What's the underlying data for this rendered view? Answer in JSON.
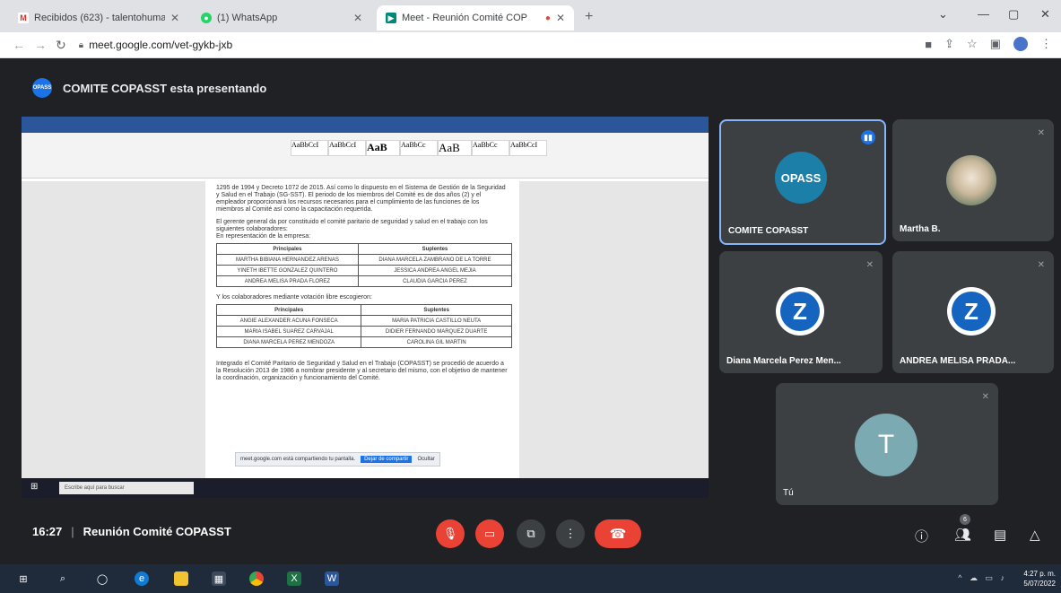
{
  "browser": {
    "tabs": [
      {
        "title": "Recibidos (623) - talentohumano",
        "active": false
      },
      {
        "title": "(1) WhatsApp",
        "active": false
      },
      {
        "title": "Meet - Reunión Comité COP",
        "active": true
      }
    ],
    "url": "meet.google.com/vet-gykb-jxb"
  },
  "meet": {
    "presenting_banner": "COMITE COPASST esta presentando",
    "presenter_badge": "OPASS",
    "time": "16:27",
    "meeting_name": "Reunión Comité COPASST",
    "participants_count": "6",
    "participants": [
      {
        "name": "COMITE COPASST",
        "avatar_text": "OPASS"
      },
      {
        "name": "Martha B."
      },
      {
        "name": "Diana Marcela Perez Men..."
      },
      {
        "name": "ANDREA MELISA PRADA..."
      },
      {
        "name": "Tú",
        "avatar_text": "T"
      }
    ]
  },
  "document": {
    "paragraph1": "1295 de 1994 y Decreto 1072 de 2015. Así como lo dispuesto en el Sistema de Gestión de la Seguridad y Salud en el Trabajo (SG-SST). El periodo de los miembros del Comité es de dos años (2) y el empleador proporcionará los recursos necesarios para el cumplimiento de las funciones de los miembros al Comité así como la capacitación requerida.",
    "paragraph2": "El gerente general da por constituido el comité paritario de seguridad y salud en el trabajo con los siguientes colaboradores:",
    "paragraph3": "En representación de la empresa:",
    "table1": {
      "headers": [
        "Principales",
        "Suplentes"
      ],
      "rows": [
        [
          "MARTHA BIBIANA HERNANDEZ ARENAS",
          "DIANA MARCELA ZAMBRANO DE LA TORRE"
        ],
        [
          "YINETH IBETTE GONZALEZ QUINTERO",
          "JESSICA ANDREA ANGEL MEJIA"
        ],
        [
          "ANDREA MELISA PRADA FLOREZ",
          "CLAUDIA GARCIA PEREZ"
        ]
      ]
    },
    "paragraph4": "Y los colaboradores mediante votación libre escogieron:",
    "table2": {
      "headers": [
        "Principales",
        "Suplentes"
      ],
      "rows": [
        [
          "ANGIE ALEXANDER ACUNA FONSECA",
          "MARIA PATRICIA CASTILLO NEUTA"
        ],
        [
          "MARIA ISABEL SUAREZ CARVAJAL",
          "DIDIER FERNANDO MARQUEZ DUARTE"
        ],
        [
          "DIANA MARCELA PEREZ MENDOZA",
          "CAROLINA GIL MARTIN"
        ]
      ]
    },
    "paragraph5": "Integrado el Comité Paritario de Seguridad y Salud en el Trabajo (COPASST) se procedió de acuerdo a la Resolución 2013 de 1986 a nombrar presidente y al secretario del mismo, con el objetivo de mantener la coordinación, organización y funcionamiento del Comité.",
    "notification_text": "meet.google.com está compartiendo tu pantalla.",
    "notification_stop": "Dejar de compartir",
    "notification_hide": "Ocultar",
    "styles": [
      "AaBbCcI",
      "AaBbCcI",
      "AaB",
      "AaBbCc",
      "AaB",
      "AaBbCc",
      "AaBbCcI"
    ],
    "search_placeholder": "Escribe aquí para buscar"
  },
  "taskbar": {
    "time": "4:27 p. m.",
    "date": "5/07/2022"
  }
}
